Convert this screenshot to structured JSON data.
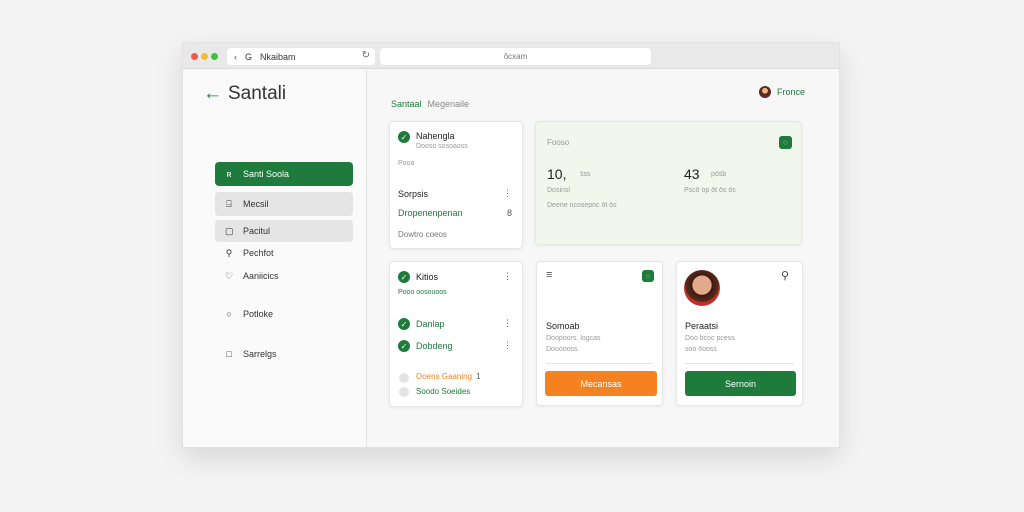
{
  "browser": {
    "tab_title": "Nkaibam",
    "tab_letter": "G",
    "url": "ôcxam"
  },
  "sidebar": {
    "brand": "Santali",
    "items": [
      {
        "label": "Santi Soola"
      },
      {
        "label": "Mecsil"
      },
      {
        "label": "Pacitul"
      },
      {
        "label": "Pechfot"
      },
      {
        "label": "Aaniicics"
      },
      {
        "label": "Potloke"
      },
      {
        "label": "Sarrelgs"
      }
    ]
  },
  "header": {
    "breadcrumb_primary": "Santaal",
    "breadcrumb_secondary": "Megenaile",
    "user_name": "Fronce"
  },
  "card_tasks": {
    "title": "Nahengla",
    "subtitle": "Dooso sosoaoss",
    "note": "Pooa",
    "section": "Sorpsis",
    "link": "Dropenenpenan",
    "count": "8",
    "footer": "Dowtro coeos"
  },
  "card_stats": {
    "title": "Fooso",
    "stat1_value": "10,",
    "stat1_suffix": "s̈ss",
    "stat1_label": "Dosinsl",
    "stat2_value": "43",
    "stat2_suffix": "pōs̈b",
    "stat2_label": "Pscō op ōt ōs ōs",
    "footer": "Deene ncosepnc ōt ōs"
  },
  "card_list": {
    "title": "Kitios",
    "subtitle": "Pooo oosouoos",
    "item1": "Danlap",
    "item2": "Dobdeng",
    "warn": "Ooens Gaaning",
    "warn_count": "1",
    "done": "Soodo Soeides"
  },
  "card_action1": {
    "title": "Somoab",
    "desc1": "Doopoors. logcas",
    "desc2": "Doooooss",
    "button": "Mecansas"
  },
  "card_action2": {
    "title": "Peraatsi",
    "desc1": "Doo bcoc pcess",
    "desc2": "soo ōooss",
    "button": "Sernoin"
  },
  "colors": {
    "accent": "#1e7b3c",
    "orange": "#f58220"
  }
}
